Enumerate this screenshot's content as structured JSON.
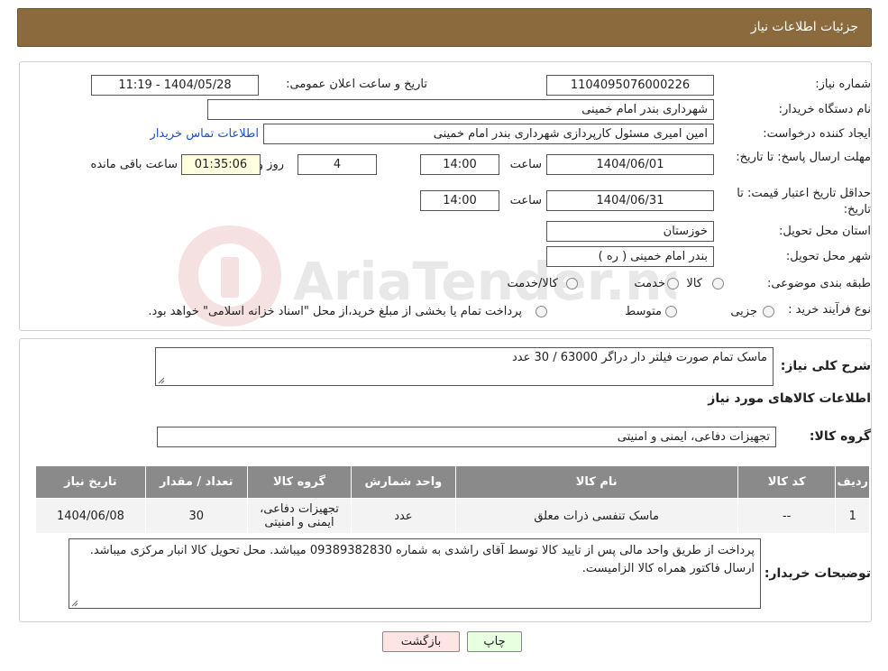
{
  "header": {
    "title": "جزئیات اطلاعات نیاز"
  },
  "form": {
    "need_number_label": "شماره نیاز:",
    "need_number": "1104095076000226",
    "announce_label": "تاریخ و ساعت اعلان عمومی:",
    "announce_value": "1404/05/28 - 11:19",
    "buyer_label": "نام دستگاه خریدار:",
    "buyer_value": "شهرداری بندر امام خمینی",
    "creator_label": "ایجاد کننده درخواست:",
    "creator_value": "امین امیری مسئول کارپردازی شهرداری بندر امام خمینی",
    "contact_link": "اطلاعات تماس خریدار",
    "deadline_label": "مهلت ارسال پاسخ: تا تاریخ:",
    "deadline_date": "1404/06/01",
    "time_label": "ساعت",
    "deadline_time": "14:00",
    "days_value": "4",
    "days_label": "روز و",
    "remaining_value": "01:35:06",
    "remaining_label": "ساعت باقی مانده",
    "validity_label": "حداقل تاریخ اعتبار قیمت: تا تاریخ:",
    "validity_date": "1404/06/31",
    "validity_time": "14:00",
    "province_label": "استان محل تحویل:",
    "province_value": "خوزستان",
    "city_label": "شهر محل تحویل:",
    "city_value": "بندر امام خمینی ( ره )",
    "category_label": "طبقه بندی موضوعی:",
    "category_options": [
      "کالا",
      "خدمت",
      "کالا/خدمت"
    ],
    "process_label": "نوع فرآیند خرید :",
    "process_options": [
      "جزیی",
      "متوسط"
    ],
    "process_note": "پرداخت تمام یا بخشی از مبلغ خرید،از محل \"اسناد خزانه اسلامی\" خواهد بود."
  },
  "details": {
    "summary_label": "شرح کلی نیاز:",
    "summary_value": "ماسک تمام صورت فیلتر دار دراگر 63000 / 30 عدد",
    "goods_info_title": "اطلاعات کالاهای مورد نیاز",
    "goods_group_label": "گروه کالا:",
    "goods_group_value": "تجهیزات دفاعی، ایمنی و امنیتی",
    "table": {
      "headers": [
        "ردیف",
        "کد کالا",
        "نام کالا",
        "واحد شمارش",
        "گروه کالا",
        "تعداد / مقدار",
        "تاریخ نیاز"
      ],
      "rows": [
        [
          "1",
          "--",
          "ماسک تنفسی ذرات معلق",
          "عدد",
          "تجهیزات دفاعی، ایمنی و امنیتی",
          "30",
          "1404/06/08"
        ]
      ]
    },
    "buyer_notes_label": "توضیحات خریدار:",
    "buyer_notes_value": "پرداخت از طریق واحد مالی پس از تایید کالا توسط آقای راشدی به شماره 09389382830 میباشد. محل تحویل کالا انبار مرکزی  میباشد. ارسال فاکتور همراه کالا الزامیست."
  },
  "buttons": {
    "print": "چاپ",
    "back": "بازگشت"
  },
  "watermark": {
    "text": "AriaTender.neT"
  },
  "colors": {
    "header_bg": "#8b6a3e",
    "print_bg": "#e8ffe0",
    "back_bg": "#ffe4e4",
    "link": "#1a4fd8"
  }
}
